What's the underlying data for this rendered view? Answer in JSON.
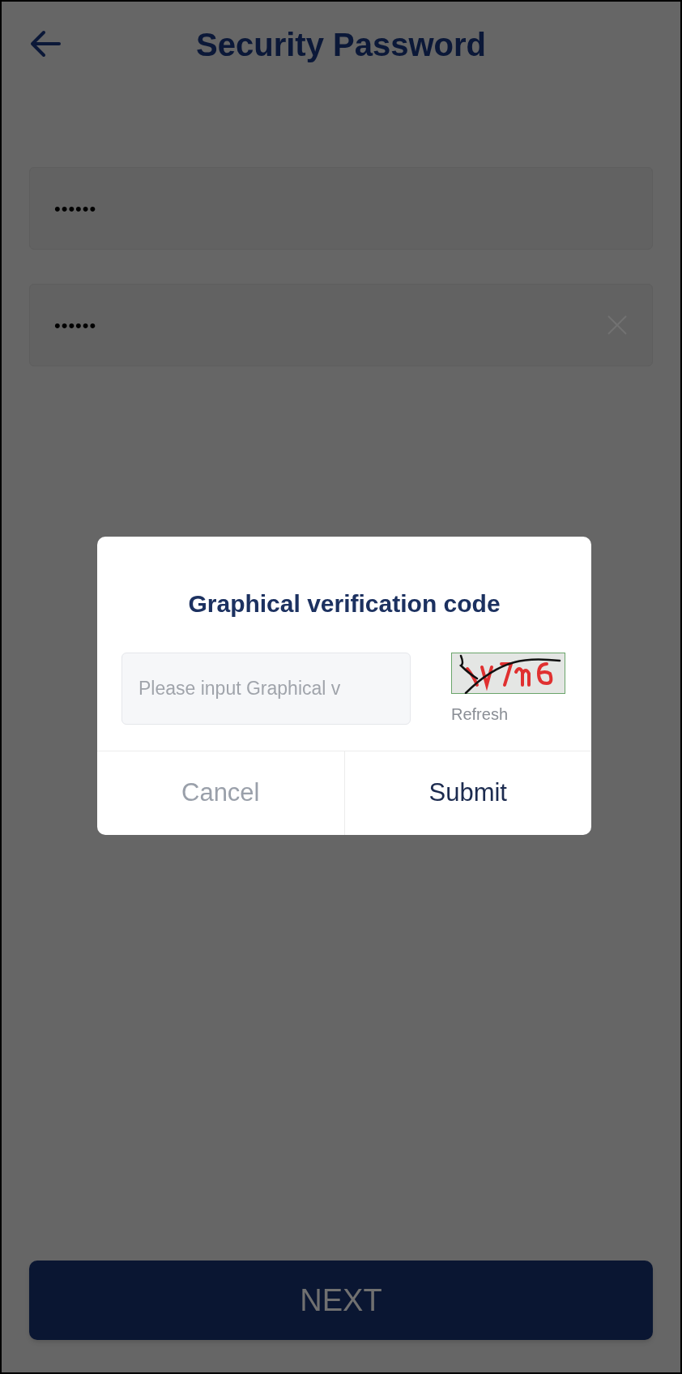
{
  "header": {
    "title": "Security Password"
  },
  "fields": [
    {
      "value": "••••••",
      "clearable": false
    },
    {
      "value": "••••••",
      "clearable": true
    }
  ],
  "dialog": {
    "title": "Graphical verification code",
    "input": {
      "placeholder": "Please input Graphical v"
    },
    "refresh": "Refresh",
    "buttons": [
      {
        "label": "Cancel",
        "kind": "secondary"
      },
      {
        "label": "Submit",
        "kind": "primary"
      }
    ]
  },
  "next_button": {
    "label": "NEXT"
  }
}
